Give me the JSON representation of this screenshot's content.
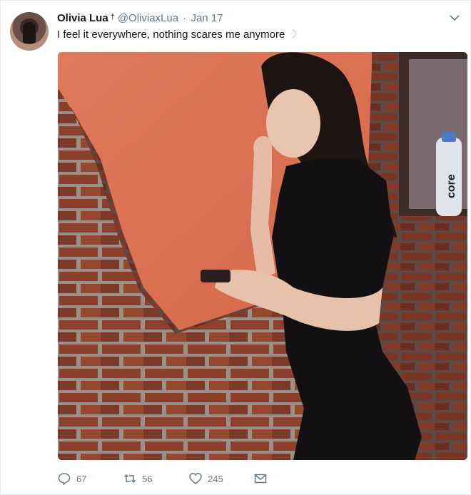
{
  "user": {
    "name": "Olivia Lua",
    "badge": "†",
    "handle": "@OliviaxLua",
    "separator": "·",
    "date": "Jan 17"
  },
  "tweet": {
    "text": "I feel it everywhere, nothing scares me anymore",
    "emoji": "☽"
  },
  "photo": {
    "bottle_label": "core"
  },
  "actions": {
    "replies": "67",
    "retweets": "56",
    "likes": "245"
  },
  "icons": [
    "avatar",
    "chevron-down-icon",
    "reply-icon",
    "retweet-icon",
    "heart-icon",
    "envelope-icon"
  ],
  "colors": {
    "muted": "#657786",
    "text": "#14171a",
    "wall": "#d97457"
  }
}
